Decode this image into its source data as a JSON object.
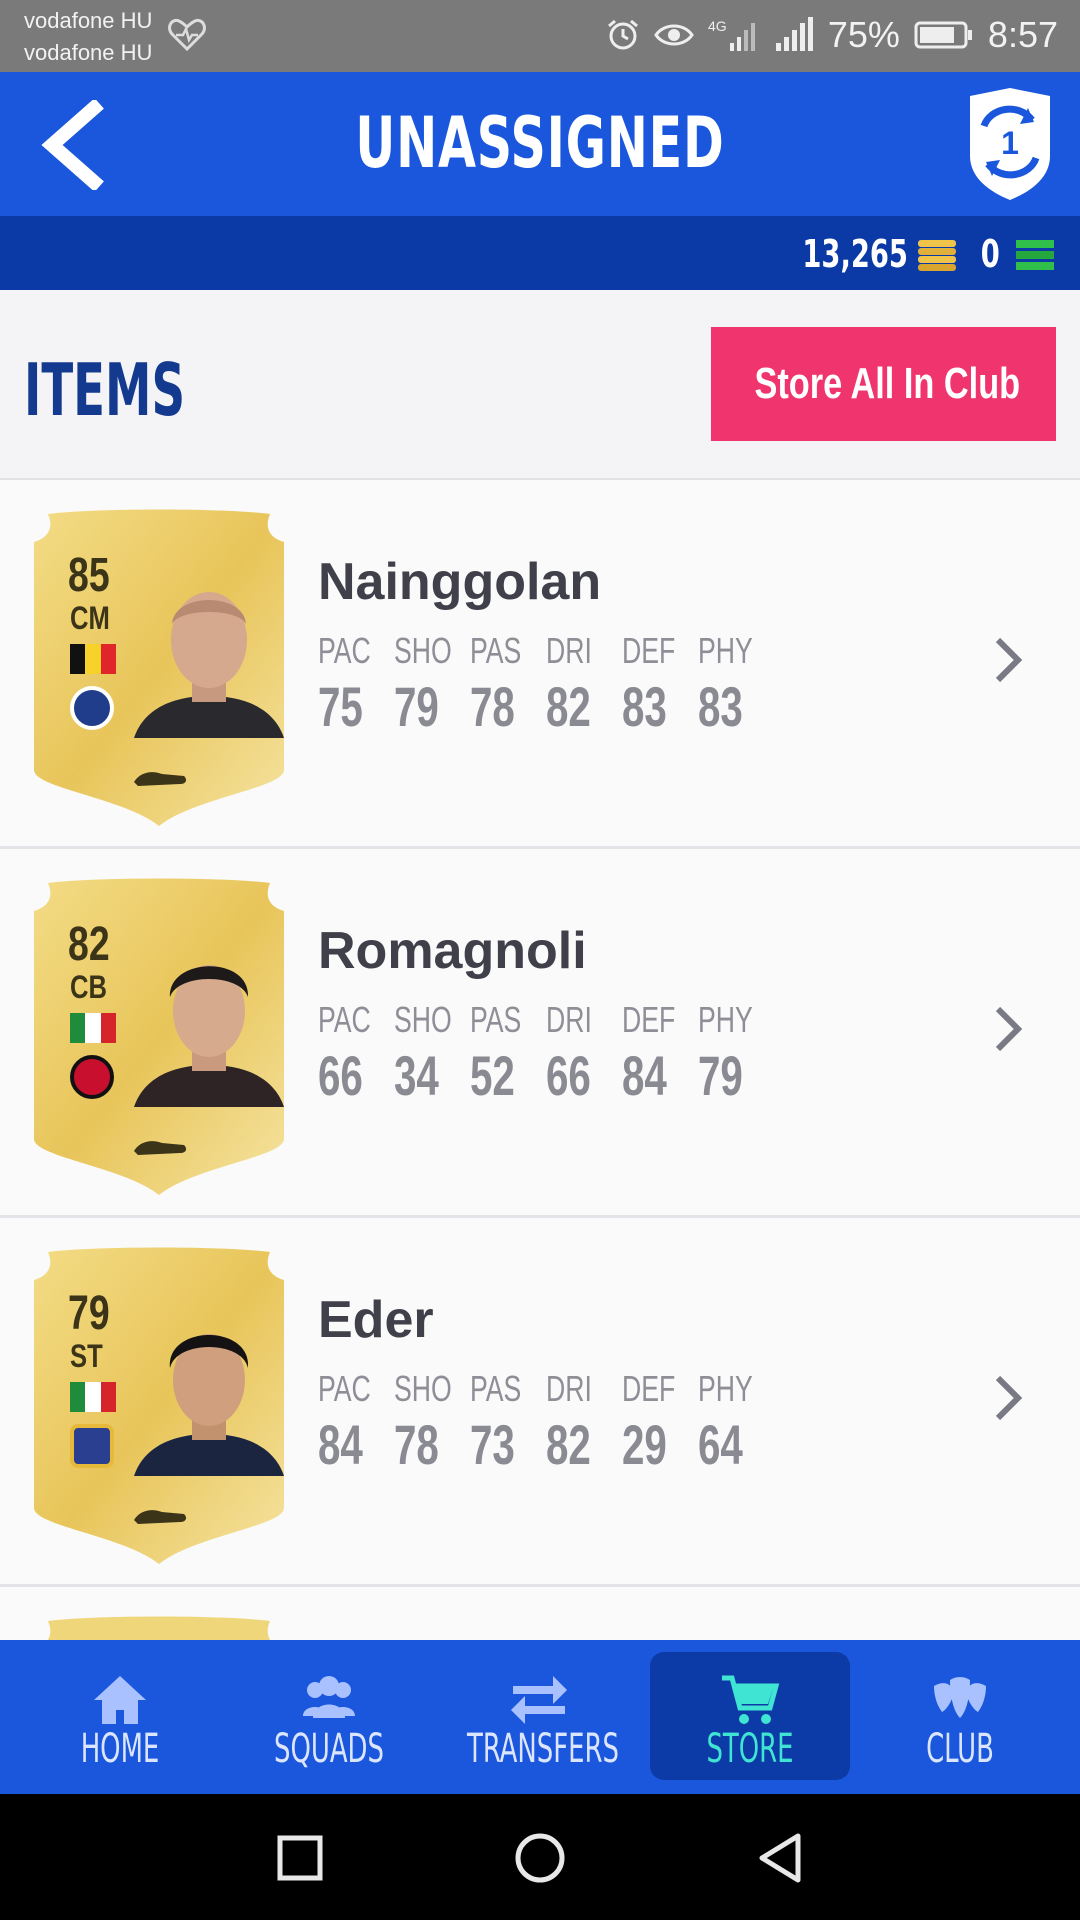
{
  "status_bar": {
    "carrier_line1": "vodafone HU",
    "carrier_line2": "vodafone HU",
    "network": "4G",
    "battery": "75%",
    "time": "8:57"
  },
  "header": {
    "title": "UNASSIGNED",
    "objectives_badge": "1"
  },
  "currency": {
    "coins": "13,265",
    "points": "0"
  },
  "items": {
    "title": "ITEMS",
    "store_all_label": "Store All In Club"
  },
  "players": [
    {
      "name": "Nainggolan",
      "rating": "85",
      "position": "CM",
      "flag_colors": [
        "#111111",
        "#f7d22b",
        "#e0262a"
      ],
      "club_color": "#1f3d8a",
      "stats": [
        {
          "label": "PAC",
          "value": "75"
        },
        {
          "label": "SHO",
          "value": "79"
        },
        {
          "label": "PAS",
          "value": "78"
        },
        {
          "label": "DRI",
          "value": "82"
        },
        {
          "label": "DEF",
          "value": "83"
        },
        {
          "label": "PHY",
          "value": "83"
        }
      ]
    },
    {
      "name": "Romagnoli",
      "rating": "82",
      "position": "CB",
      "flag_colors": [
        "#1e8c3a",
        "#ffffff",
        "#d6242b"
      ],
      "club_color": "#c8102e",
      "stats": [
        {
          "label": "PAC",
          "value": "66"
        },
        {
          "label": "SHO",
          "value": "34"
        },
        {
          "label": "PAS",
          "value": "52"
        },
        {
          "label": "DRI",
          "value": "66"
        },
        {
          "label": "DEF",
          "value": "84"
        },
        {
          "label": "PHY",
          "value": "79"
        }
      ]
    },
    {
      "name": "Eder",
      "rating": "79",
      "position": "ST",
      "flag_colors": [
        "#1e8c3a",
        "#ffffff",
        "#d6242b"
      ],
      "club_color": "#2a3f8f",
      "stats": [
        {
          "label": "PAC",
          "value": "84"
        },
        {
          "label": "SHO",
          "value": "78"
        },
        {
          "label": "PAS",
          "value": "73"
        },
        {
          "label": "DRI",
          "value": "82"
        },
        {
          "label": "DEF",
          "value": "29"
        },
        {
          "label": "PHY",
          "value": "64"
        }
      ]
    }
  ],
  "nav": [
    {
      "label": "HOME",
      "icon": "home-icon"
    },
    {
      "label": "SQUADS",
      "icon": "squads-icon"
    },
    {
      "label": "TRANSFERS",
      "icon": "transfers-icon"
    },
    {
      "label": "STORE",
      "icon": "cart-icon",
      "active": true
    },
    {
      "label": "CLUB",
      "icon": "club-icon"
    }
  ],
  "colors": {
    "primary_blue": "#1a57dc",
    "dark_blue": "#0b3aa6",
    "accent_pink": "#f0356e",
    "active_teal": "#3fe4d2",
    "card_gold": "#ecd06a"
  }
}
